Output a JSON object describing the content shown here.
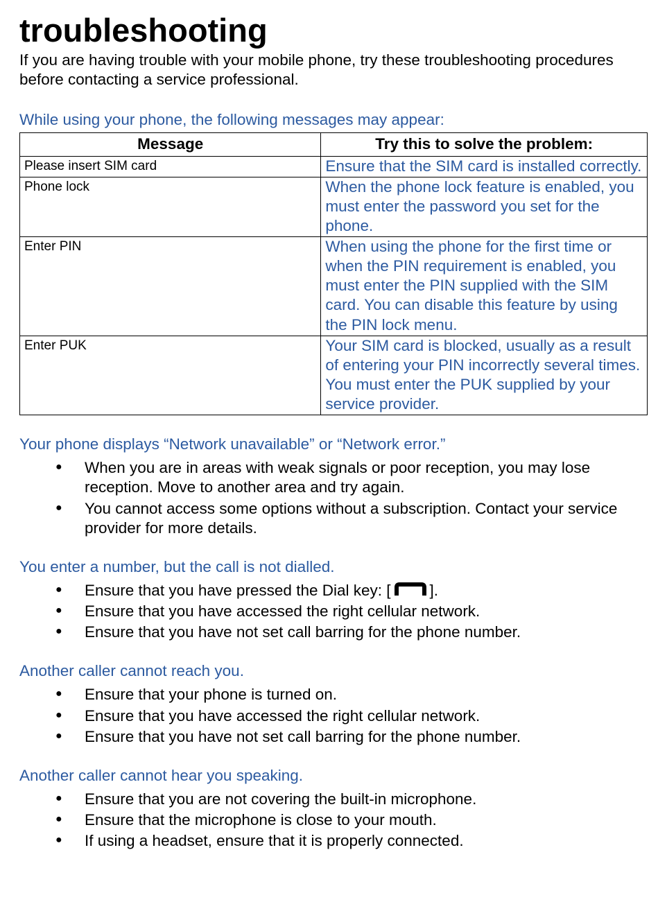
{
  "title": "troubleshooting",
  "intro": "If you are having trouble with your mobile phone, try these troubleshooting procedures before contacting a service professional.",
  "tableSection": {
    "heading": "While using your phone, the following messages may appear:",
    "headers": {
      "col1": "Message",
      "col2": "Try this to solve the problem:"
    },
    "rows": [
      {
        "message": "Please insert SIM card",
        "fix": "Ensure that the SIM card is installed correctly."
      },
      {
        "message": "Phone lock",
        "fix": "When the phone lock feature is enabled, you must enter the password you set for the phone."
      },
      {
        "message": "Enter PIN",
        "fix": "When using the phone for the first time or when the PIN requirement is enabled, you must enter the PIN supplied with the SIM card. You can disable this feature by using the PIN lock    menu."
      },
      {
        "message": "Enter PUK",
        "fix": "Your SIM card is blocked, usually as a result of entering your PIN incorrectly several times. You must enter the PUK supplied by your service provider."
      }
    ]
  },
  "sections": [
    {
      "heading": "Your phone displays “Network unavailable” or “Network error.”",
      "items": [
        "When you are in areas with weak signals or poor reception, you may lose reception. Move to another area and try again.",
        "You cannot access some options without a subscription. Contact your service provider for more details."
      ]
    },
    {
      "heading": "You enter a number, but the call is not dialled.",
      "dialItem": {
        "before": "Ensure that you have pressed the Dial key: [",
        "after": "]."
      },
      "items": [
        "Ensure that you have accessed the right cellular network.",
        "Ensure that you have not set call barring for the phone number."
      ]
    },
    {
      "heading": "Another caller cannot reach you.",
      "items": [
        "Ensure that your phone is turned on.",
        "Ensure that you have accessed the right cellular network.",
        "Ensure that you have not set call barring for the phone number."
      ]
    },
    {
      "heading": "Another caller cannot hear you speaking.",
      "items": [
        "Ensure that you are not covering the built-in microphone.",
        "Ensure that the microphone is close to your mouth.",
        "If using a headset, ensure that it is properly connected."
      ]
    }
  ]
}
